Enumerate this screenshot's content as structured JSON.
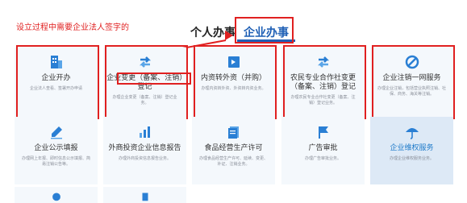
{
  "annotation": "设立过程中需要企业法人签字的",
  "tabs": {
    "personal": "个人办事",
    "enterprise": "企业办事"
  },
  "colors": {
    "accent": "#1e7ac9",
    "highlight_red": "#e02020",
    "card_bg": "#f4f8fc"
  },
  "services": [
    {
      "title": "企业开办",
      "desc": "企业法人查看、签署开办申请",
      "icon": "building-icon"
    },
    {
      "title": "企业变更（备案、注销）登记",
      "desc": "办理企业变更（备案、注销）登记业务。",
      "icon": "exchange-arrows-icon"
    },
    {
      "title": "内资转外资（并购）",
      "desc": "办理内资转外资、外资转内资业务。",
      "icon": "transfer-box-icon"
    },
    {
      "title": "农民专业合作社变更（备案、注销）登记",
      "desc": "办理农民专业合作社变更（备案、注销）登记业务。",
      "icon": "exchange-arrows-icon"
    },
    {
      "title": "企业注销一网服务",
      "desc": "办理企业注销，包括营业执照注销、社保、商务、海关等注销。",
      "icon": "ban-circle-icon"
    },
    {
      "title": "企业公示填报",
      "desc": "办理网上年报、即时信息公示填报、简易注销公告等。",
      "icon": "pen-icon"
    },
    {
      "title": "外商投资企业信息报告",
      "desc": "办理外商投资信息报告业务。",
      "icon": "bar-chart-icon"
    },
    {
      "title": "食品经营生产许可",
      "desc": "办理食品经营生产许可、延续、变更、补证、注销业务。",
      "icon": "document-stack-icon"
    },
    {
      "title": "广告审批",
      "desc": "办理广告审批业务。",
      "icon": "flag-icon"
    },
    {
      "title": "企业维权服务",
      "desc": "办理企业维权服务业务。",
      "icon": "umbrella-icon"
    }
  ]
}
